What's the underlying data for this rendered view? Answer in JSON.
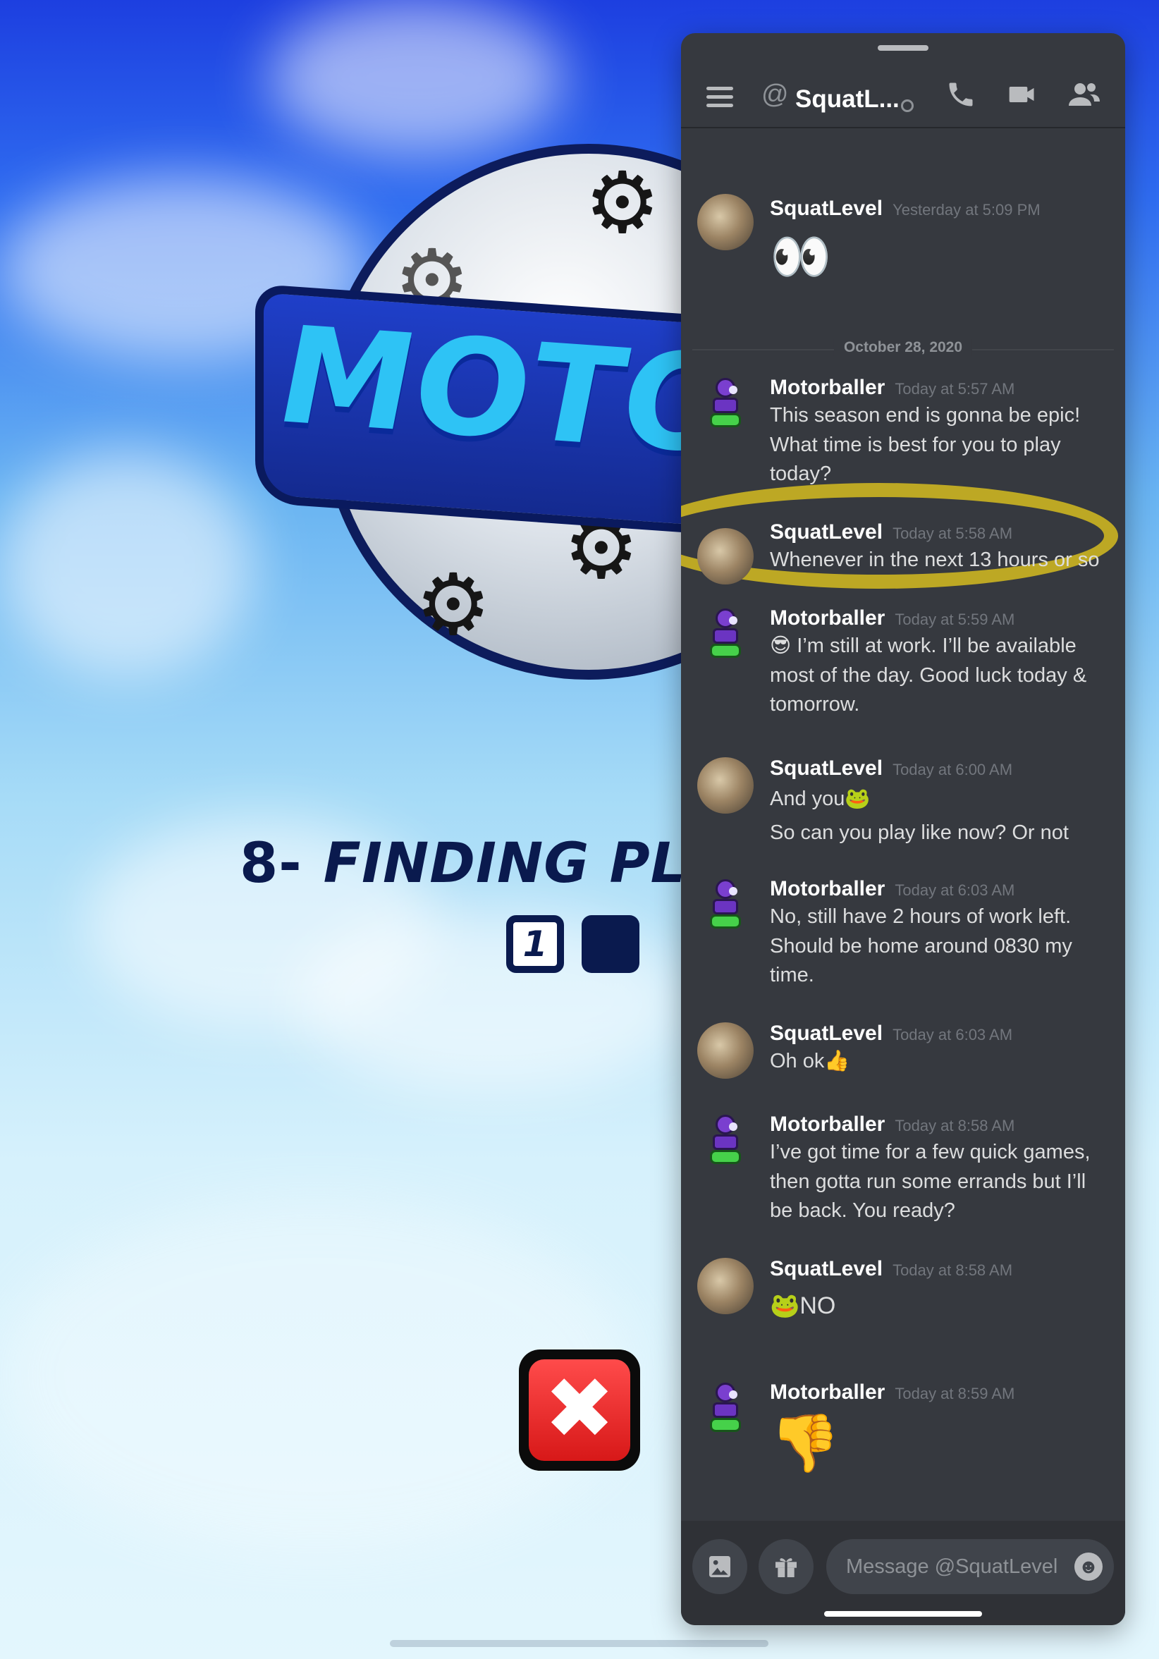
{
  "game": {
    "logo_text": "MOTORB",
    "finding_text": "FINDING PLA",
    "key_glyph": "8-",
    "slot_number": "1",
    "cancel_glyph": "✖"
  },
  "chat": {
    "header": {
      "title": "SquatL...",
      "at_glyph": "@"
    },
    "date_divider": "October 28, 2020",
    "messages": [
      {
        "author": "SquatLevel",
        "timestamp": "Yesterday at 5:09 PM",
        "lines": [
          "👀"
        ]
      },
      {
        "author": "Motorballer",
        "timestamp": "Today at 5:57 AM",
        "lines": [
          "This season end is gonna be epic!",
          "What time is best for you to play",
          "today?"
        ]
      },
      {
        "author": "SquatLevel",
        "timestamp": "Today at 5:58 AM",
        "lines": [
          "Whenever in the next 13 hours or so"
        ]
      },
      {
        "author": "Motorballer",
        "timestamp": "Today at 5:59 AM",
        "lines": [
          "😎 I’m still at work.  I’ll be available",
          "most of the day.  Good luck today &",
          "tomorrow."
        ]
      },
      {
        "author": "SquatLevel",
        "timestamp": "Today at 6:00 AM",
        "lines": [
          "And you🐸",
          "So can you play like now? Or not"
        ]
      },
      {
        "author": "Motorballer",
        "timestamp": "Today at 6:03 AM",
        "lines": [
          "No, still have 2 hours of work left.",
          "Should be home around 0830 my",
          "time."
        ]
      },
      {
        "author": "SquatLevel",
        "timestamp": "Today at 6:03 AM",
        "lines": [
          "Oh ok👍"
        ]
      },
      {
        "author": "Motorballer",
        "timestamp": "Today at 8:58 AM",
        "lines": [
          "I’ve got time for a few quick games,",
          "then gotta run some errands but I’ll",
          "be back.  You ready?"
        ]
      },
      {
        "author": "SquatLevel",
        "timestamp": "Today at 8:58 AM",
        "lines": [
          "🐸NO"
        ]
      },
      {
        "author": "Motorballer",
        "timestamp": "Today at 8:59 AM",
        "lines": [
          "👎"
        ]
      }
    ],
    "composer": {
      "placeholder": "Message @SquatLevel"
    }
  },
  "colors": {
    "panel_bg": "#36393f",
    "composer_bg": "#2f3136",
    "highlight": "#e0c41e"
  }
}
